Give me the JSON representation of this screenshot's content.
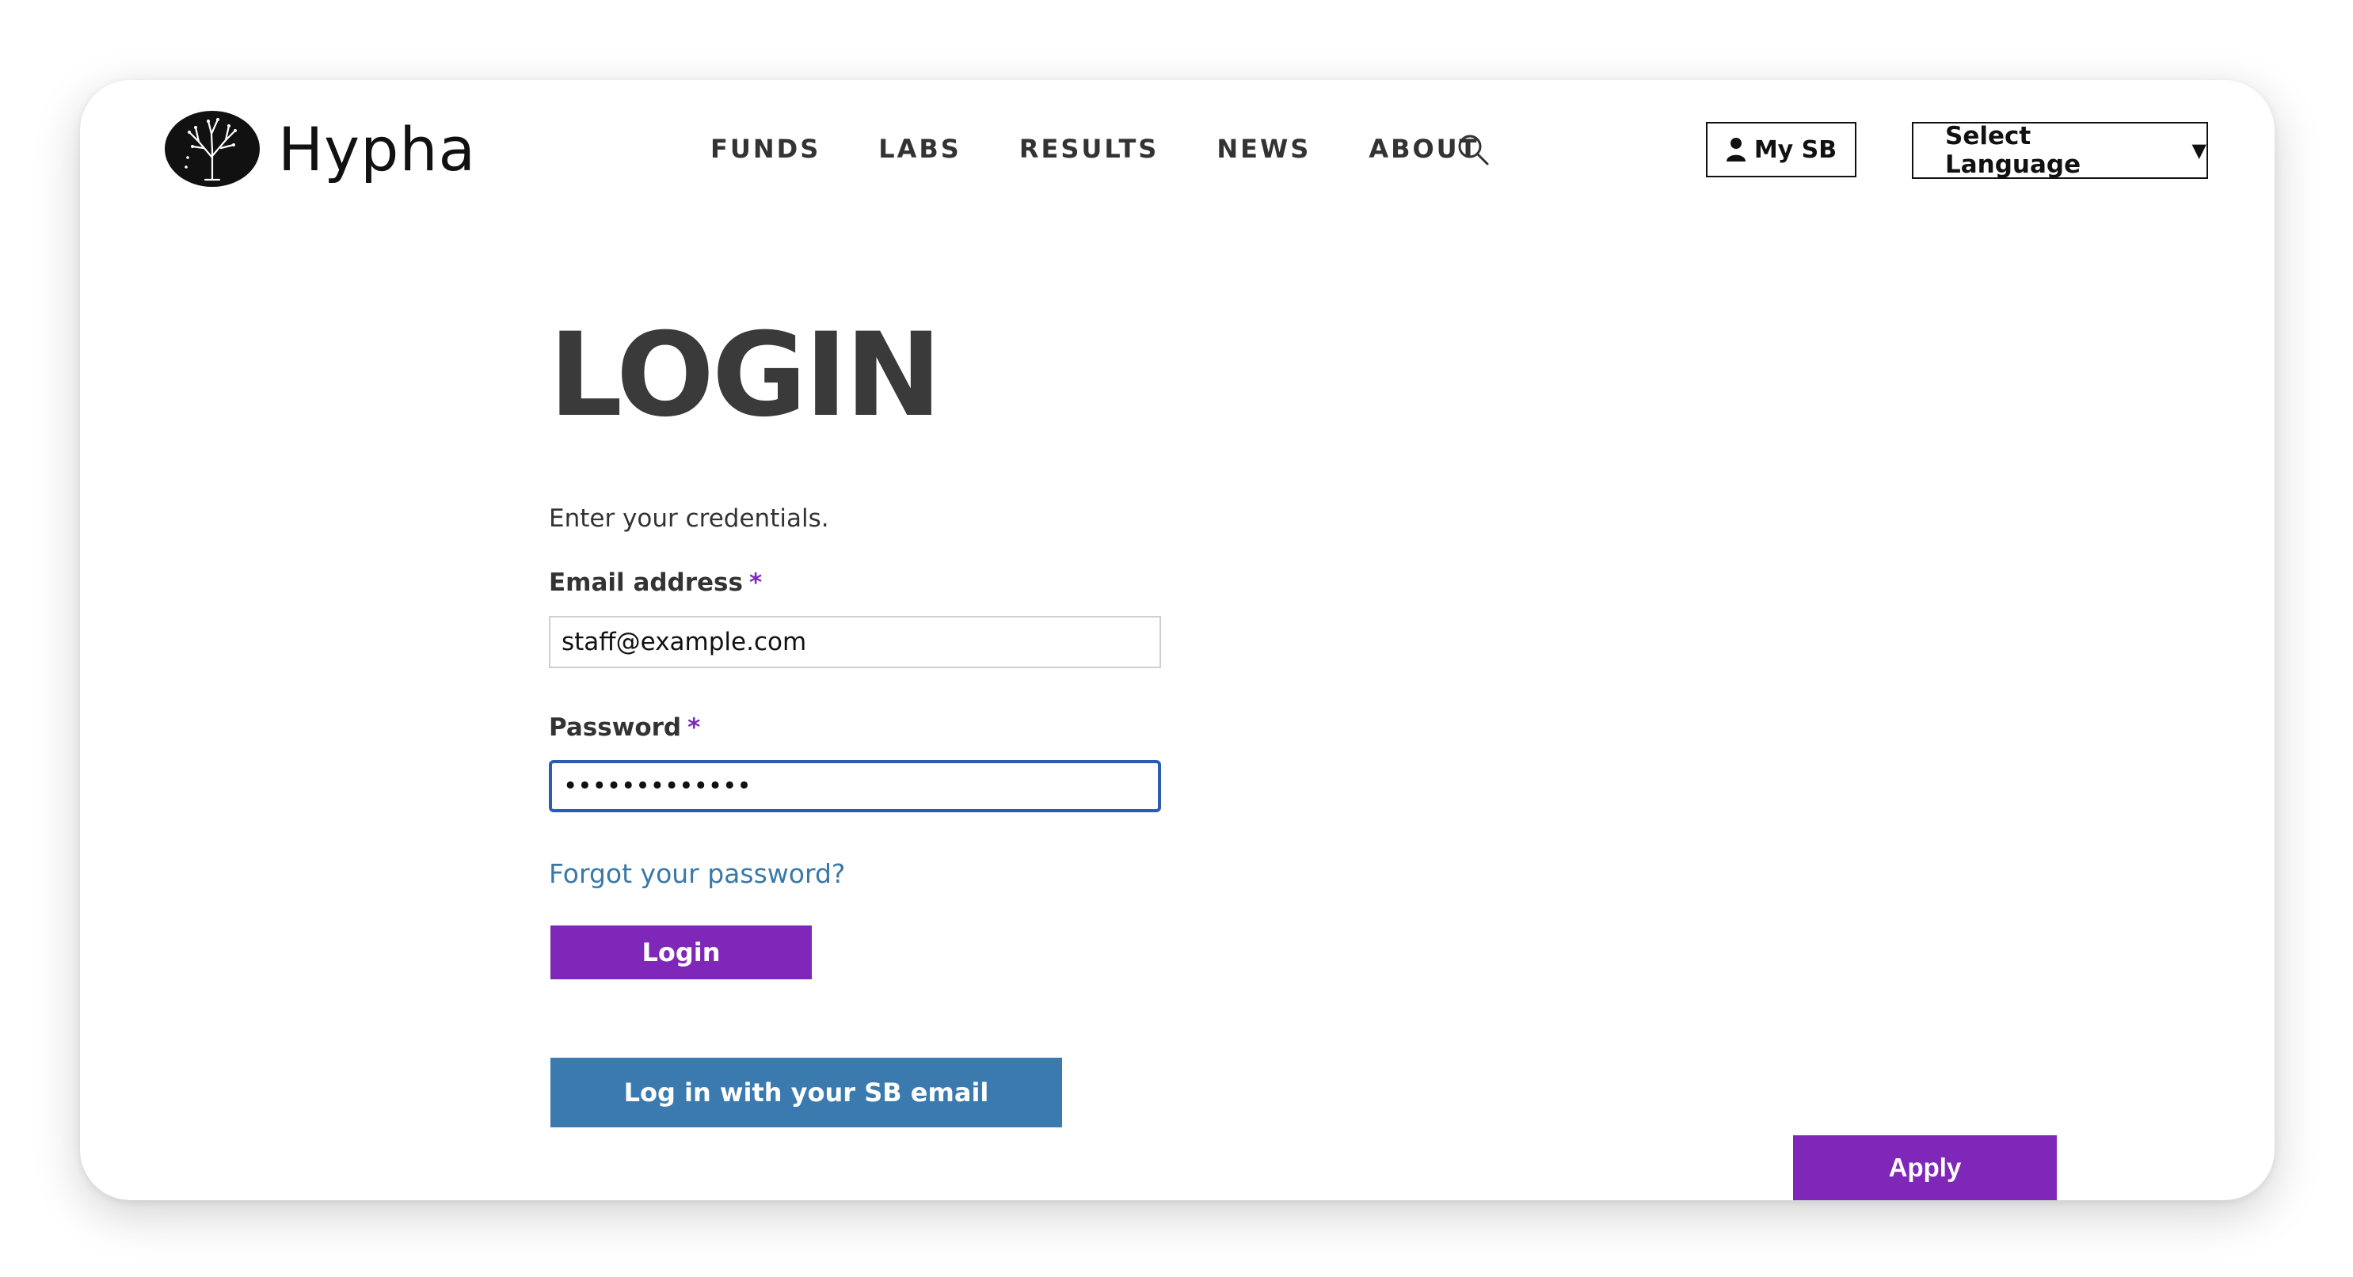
{
  "header": {
    "logo_text": "Hypha",
    "nav": [
      {
        "label": "FUNDS"
      },
      {
        "label": "LABS"
      },
      {
        "label": "RESULTS"
      },
      {
        "label": "NEWS"
      },
      {
        "label": "ABOUT"
      }
    ],
    "my_sb_label": "My SB",
    "language_select_label": "Select Language",
    "language_caret": "▼"
  },
  "login": {
    "title": "LOGIN",
    "intro": "Enter your credentials.",
    "email_label": "Email address",
    "email_value": "staff@example.com",
    "password_label": "Password",
    "password_value": "•••••••••••••",
    "required_mark": "*",
    "forgot_password": "Forgot your password?",
    "login_button": "Login",
    "sso_button": "Log in with your SB email"
  },
  "apply_button": "Apply",
  "colors": {
    "purple": "#7f27b8",
    "blue_button": "#3a7aae",
    "link_blue": "#3a78a8",
    "focus_blue": "#2a5db0",
    "title_gray": "#3a3a3a"
  },
  "icons": {
    "logo": "tree-logo-icon",
    "search": "search-icon",
    "user": "user-icon",
    "caret": "caret-down-icon"
  }
}
